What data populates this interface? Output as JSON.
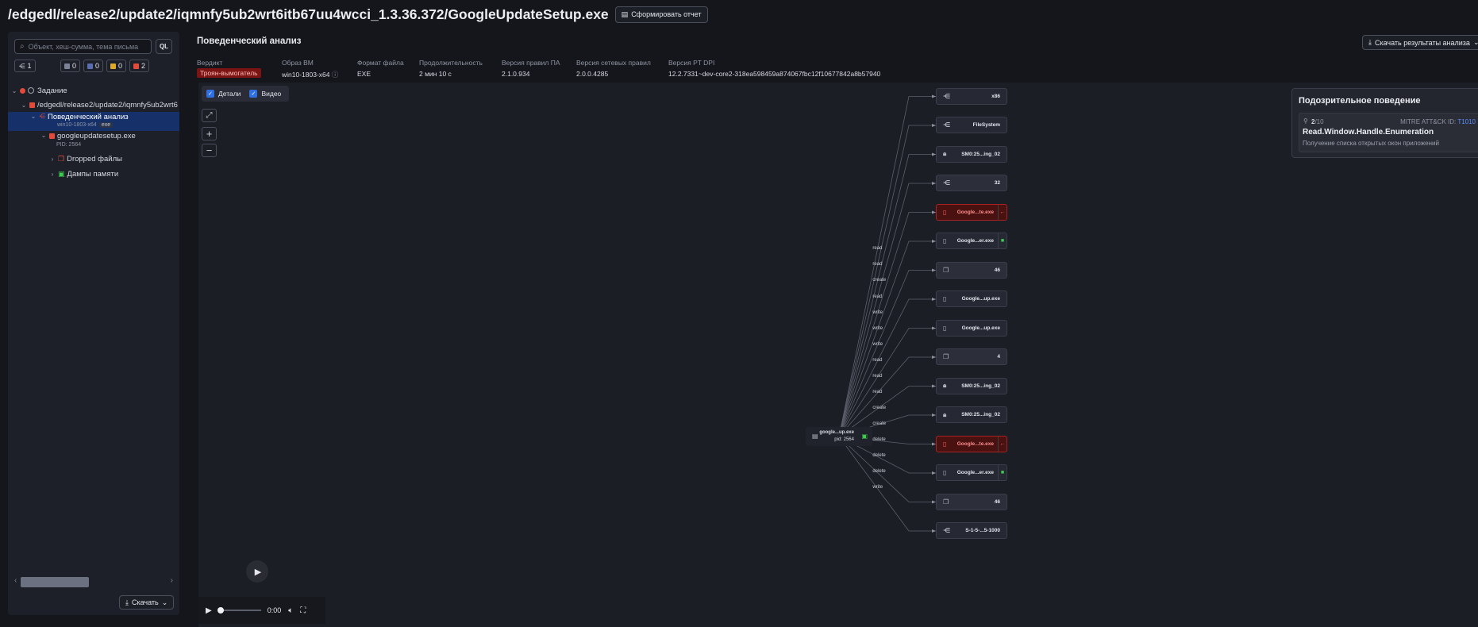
{
  "header": {
    "path": "/edgedl/release2/update2/iqmnfy5ub2wrt6itb67uu4wcci_1.3.36.372/GoogleUpdateSetup.exe",
    "report_button": "Сформировать отчет"
  },
  "sidebar": {
    "search_placeholder": "Объект, хеш-сумма, тема письма",
    "ql": "QL",
    "counters": [
      {
        "icon": "share-icon",
        "value": "1"
      },
      {
        "icon": "gray-square",
        "value": "0",
        "color": "#7b8294"
      },
      {
        "icon": "blue-square",
        "value": "0",
        "color": "#5a6db0"
      },
      {
        "icon": "yellow-square",
        "value": "0",
        "color": "#e0a829"
      },
      {
        "icon": "red-square",
        "value": "2",
        "color": "#e24a3a"
      }
    ],
    "tree": [
      {
        "label": "Задание"
      },
      {
        "label": "/edgedl/release2/update2/iqmnfy5ub2wrt6"
      },
      {
        "label": "Поведенческий анализ",
        "sub": "win10-1803-x64",
        "tag": "exe"
      },
      {
        "label": "googleupdatesetup.exe",
        "sub": "PID: 2564"
      },
      {
        "label": "Dropped файлы"
      },
      {
        "label": "Дампы памяти"
      }
    ],
    "download": "Скачать"
  },
  "main": {
    "title": "Поведенческий анализ",
    "download_results": "Скачать результаты анализа",
    "meta": [
      {
        "label": "Вердикт",
        "value": "Троян-вымогатель"
      },
      {
        "label": "Образ ВМ",
        "value": "win10-1803-x64"
      },
      {
        "label": "Формат файла",
        "value": "EXE"
      },
      {
        "label": "Продолжительность",
        "value": "2 мин 10 с"
      },
      {
        "label": "Версия правил ПА",
        "value": "2.1.0.934"
      },
      {
        "label": "Версия сетевых правил",
        "value": "2.0.0.4285"
      },
      {
        "label": "Версия PT DPI",
        "value": "12.2.7331~dev-core2-318ea598459a874067fbc12f10677842a8b57940"
      }
    ]
  },
  "graph": {
    "toggles": {
      "details": "Детали",
      "video": "Видео"
    },
    "root": {
      "name": "google...up.exe",
      "pid": "pid: 2564"
    },
    "nodes": [
      {
        "label": "x86",
        "icon": "registry-icon",
        "kind": "plain"
      },
      {
        "label": "FileSystem",
        "icon": "registry-icon",
        "kind": "plain"
      },
      {
        "label": "SM0:25...ing_02",
        "icon": "lock-icon",
        "kind": "plain"
      },
      {
        "label": "32",
        "icon": "registry-icon",
        "kind": "boxed"
      },
      {
        "label": "Google...te.exe",
        "icon": "file-icon",
        "kind": "red",
        "mark": "←",
        "markColor": "#ff6060"
      },
      {
        "label": "Google...er.exe",
        "icon": "file-icon",
        "kind": "plain",
        "mark": "■",
        "markColor": "#3ccf4e"
      },
      {
        "label": "46",
        "icon": "copy-icon",
        "kind": "boxed"
      },
      {
        "label": "Google...up.exe",
        "icon": "file-icon",
        "kind": "plain"
      },
      {
        "label": "Google...up.exe",
        "icon": "file-icon",
        "kind": "plain"
      },
      {
        "label": "4",
        "icon": "copy-icon",
        "kind": "boxed"
      },
      {
        "label": "SM0:25...ing_02",
        "icon": "lock-icon",
        "kind": "plain"
      },
      {
        "label": "SM0:25...ing_02",
        "icon": "lock-icon",
        "kind": "plain"
      },
      {
        "label": "Google...te.exe",
        "icon": "file-icon",
        "kind": "red",
        "mark": "←",
        "markColor": "#ff6060"
      },
      {
        "label": "Google...er.exe",
        "icon": "file-icon",
        "kind": "plain",
        "mark": "■",
        "markColor": "#3ccf4e"
      },
      {
        "label": "46",
        "icon": "copy-icon",
        "kind": "boxed"
      },
      {
        "label": "S-1-5-...5-1000",
        "icon": "registry-icon",
        "kind": "plain"
      }
    ],
    "edges": [
      "read",
      "read",
      "create",
      "read",
      "write",
      "write",
      "write",
      "read",
      "read",
      "read",
      "create",
      "create",
      "delete",
      "delete",
      "delete",
      "write"
    ]
  },
  "suspicious": {
    "title": "Подозрительное поведение",
    "count": "2",
    "total": "/10",
    "mitre_label": "MITRE ATT&CK ID:",
    "mitre_id": "T1010",
    "name": "Read.Window.Handle.Enumeration",
    "desc": "Получение списка открытых окон приложений"
  },
  "player": {
    "time": "0:00"
  }
}
